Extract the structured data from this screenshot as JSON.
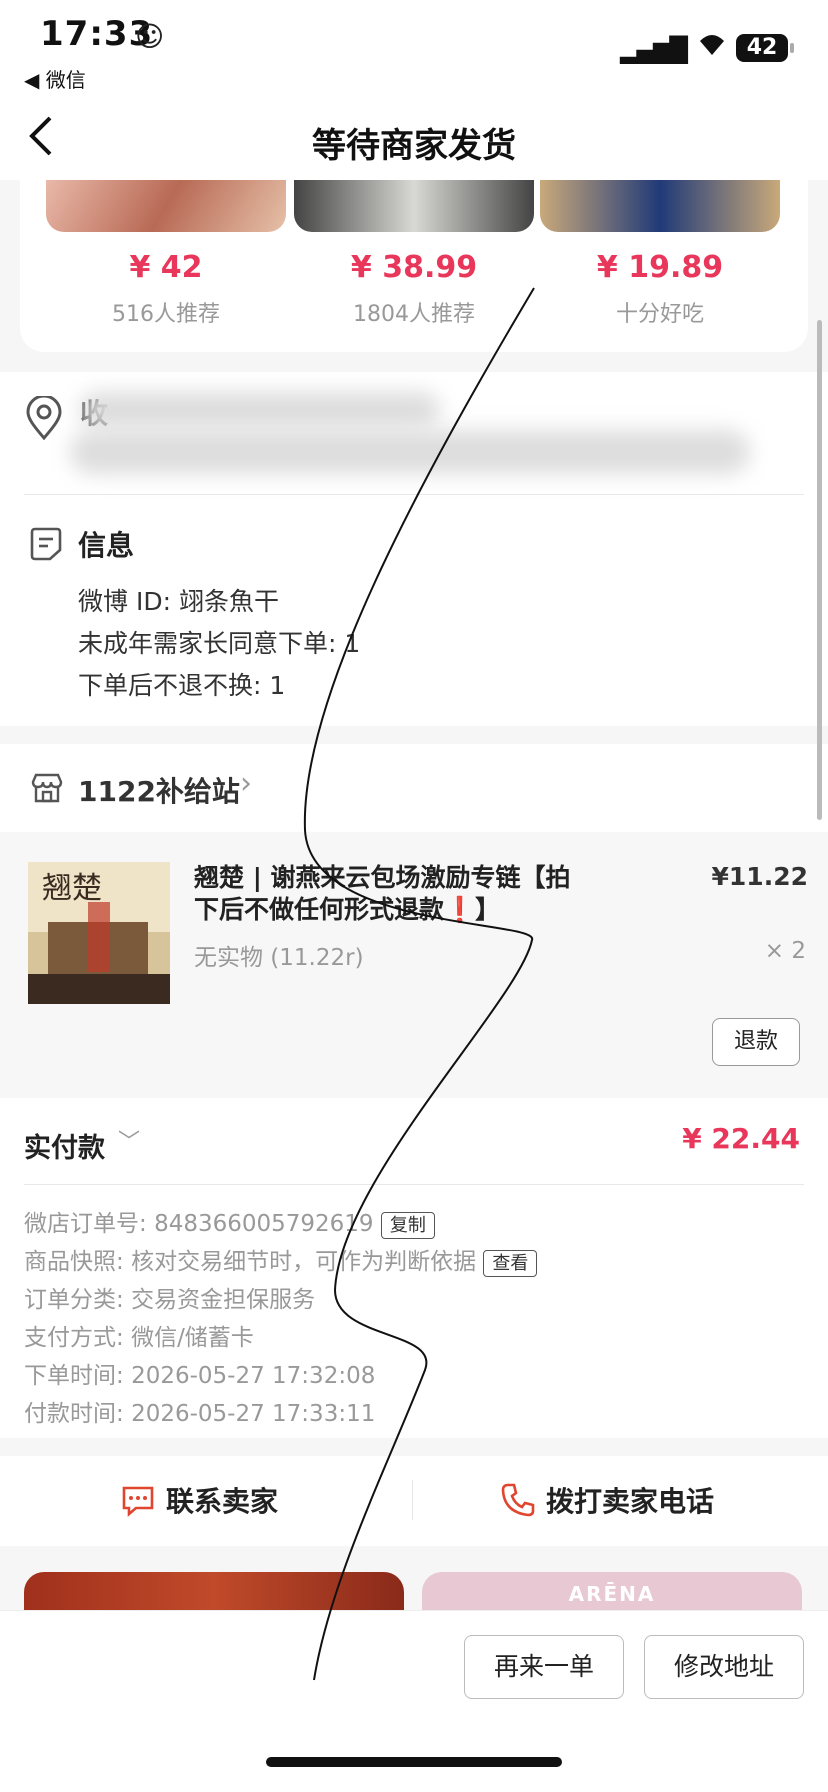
{
  "status": {
    "time": "17:33",
    "back_app": "微信",
    "battery": "42"
  },
  "nav": {
    "title": "等待商家发货"
  },
  "recommend": [
    {
      "price": "¥ 42",
      "sub": "516人推荐"
    },
    {
      "price": "¥ 38.99",
      "sub": "1804人推荐"
    },
    {
      "price": "¥ 19.89",
      "sub": "十分好吃"
    }
  ],
  "address": {
    "label_partial": "收"
  },
  "info": {
    "title": "信息",
    "lines": [
      "微博 ID: 翊条魚干",
      "未成年需家长同意下单: 1",
      "下单后不退不换: 1"
    ]
  },
  "shop": {
    "name": "1122补给站"
  },
  "product": {
    "title": "翘楚 | 谢燕来云包场激励专链【拍下后不做任何形式退款❗】",
    "price": "¥11.22",
    "spec": "无实物 (11.22r)",
    "qty": "× 2",
    "refund": "退款"
  },
  "payment": {
    "label": "实付款",
    "amount": "¥ 22.44",
    "order_no_label": "微店订单号:",
    "order_no": "848366005792619",
    "copy": "复制",
    "snapshot_label": "商品快照:",
    "snapshot": "核对交易细节时，可作为判断依据",
    "view": "查看",
    "category_label": "订单分类:",
    "category": "交易资金担保服务",
    "method_label": "支付方式:",
    "method": "微信/储蓄卡",
    "order_time_label": "下单时间:",
    "order_time": "2026-05-27 17:32:08",
    "pay_time_label": "付款时间:",
    "pay_time": "2026-05-27 17:33:11"
  },
  "contact": {
    "seller": "联系卖家",
    "phone": "拨打卖家电话"
  },
  "feed": {
    "brand": "ARĒNA"
  },
  "bottom": {
    "reorder": "再来一单",
    "edit_address": "修改地址"
  },
  "colors": {
    "accent": "#e8375a"
  }
}
